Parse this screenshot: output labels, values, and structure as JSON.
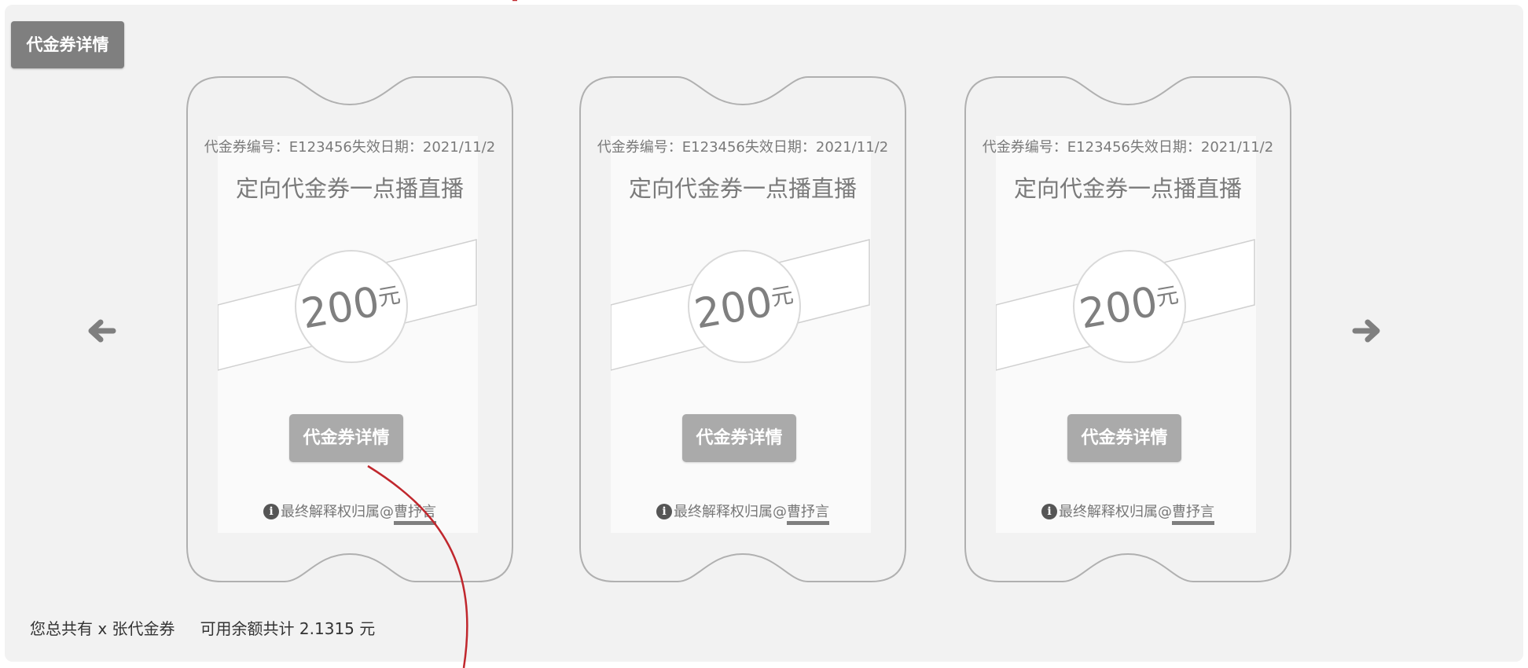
{
  "header": {
    "title": "代金券详情"
  },
  "nav": {
    "prev_icon": "arrow-left-icon",
    "next_icon": "arrow-right-icon"
  },
  "vouchers": [
    {
      "code_line": "代金券编号：E123456失效日期：2021/11/2",
      "title": "定向代金券一点播直播",
      "amount": "200",
      "unit": "元",
      "button": "代金券详情",
      "footer_prefix": "最终解释权归属@",
      "footer_author": "曹抒言"
    },
    {
      "code_line": "代金券编号：E123456失效日期：2021/11/2",
      "title": "定向代金券一点播直播",
      "amount": "200",
      "unit": "元",
      "button": "代金券详情",
      "footer_prefix": "最终解释权归属@",
      "footer_author": "曹抒言"
    },
    {
      "code_line": "代金券编号：E123456失效日期：2021/11/2",
      "title": "定向代金券一点播直播",
      "amount": "200",
      "unit": "元",
      "button": "代金券详情",
      "footer_prefix": "最终解释权归属@",
      "footer_author": "曹抒言"
    }
  ],
  "summary": {
    "total": "您总共有 x 张代金券",
    "balance": "可用余额共计 2.1315 元"
  },
  "colors": {
    "panel_bg": "#f2f2f2",
    "header_btn": "#7f7f7f",
    "card_btn": "#aaaaaa",
    "annotation_line": "#c0272d"
  }
}
